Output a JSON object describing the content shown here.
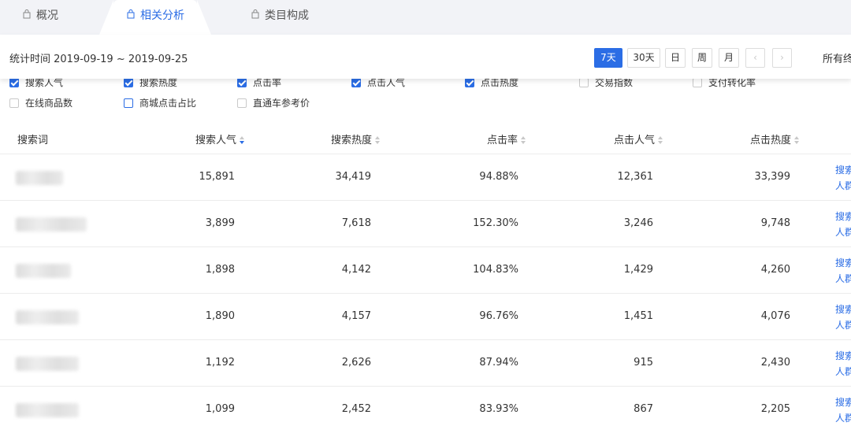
{
  "tabs": [
    {
      "label": "概况",
      "active": false
    },
    {
      "label": "相关分析",
      "active": true
    },
    {
      "label": "类目构成",
      "active": false
    }
  ],
  "toolbar": {
    "stat_time": "统计时间 2019-09-19 ~ 2019-09-25",
    "periods": [
      "7天",
      "30天",
      "日",
      "周",
      "月"
    ],
    "active_period": "7天",
    "prev": "‹",
    "next": "›",
    "all_end": "所有终"
  },
  "checkboxes": [
    {
      "label": "搜索人气",
      "checked": true
    },
    {
      "label": "搜索热度",
      "checked": true
    },
    {
      "label": "点击率",
      "checked": true
    },
    {
      "label": "点击人气",
      "checked": true
    },
    {
      "label": "点击热度",
      "checked": true
    },
    {
      "label": "交易指数",
      "checked": false
    },
    {
      "label": "支付转化率",
      "checked": false
    },
    {
      "label": "在线商品数",
      "checked": false
    },
    {
      "label": "商城点击占比",
      "checked": false
    },
    {
      "label": "直通车参考价",
      "checked": false
    }
  ],
  "table": {
    "headers": [
      "搜索词",
      "搜索人气",
      "搜索热度",
      "点击率",
      "点击人气",
      "点击热度"
    ],
    "sorted_column": "搜索人气",
    "rows": [
      [
        "15,891",
        "34,419",
        "94.88%",
        "12,361",
        "33,399"
      ],
      [
        "3,899",
        "7,618",
        "152.30%",
        "3,246",
        "9,748"
      ],
      [
        "1,898",
        "4,142",
        "104.83%",
        "1,429",
        "4,260"
      ],
      [
        "1,890",
        "4,157",
        "96.76%",
        "1,451",
        "4,076"
      ],
      [
        "1,192",
        "2,626",
        "87.94%",
        "915",
        "2,430"
      ],
      [
        "1,099",
        "2,452",
        "83.93%",
        "867",
        "2,205"
      ]
    ],
    "ops": [
      "搜索",
      "人群"
    ]
  },
  "colors": {
    "accent": "#2b6de5",
    "tab_bg": "#f2f3f7"
  }
}
